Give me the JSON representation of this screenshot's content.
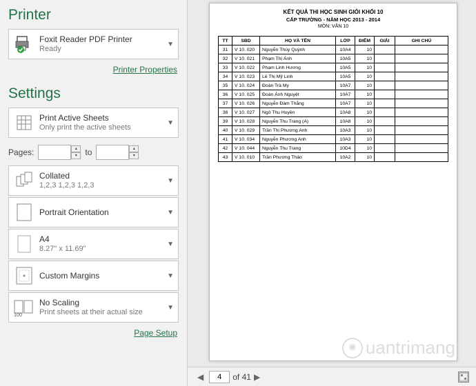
{
  "printer": {
    "section": "Printer",
    "name": "Foxit Reader PDF Printer",
    "status": "Ready",
    "properties_link": "Printer Properties"
  },
  "settings": {
    "section": "Settings",
    "print_area": {
      "main": "Print Active Sheets",
      "sub": "Only print the active sheets"
    },
    "pages": {
      "label": "Pages:",
      "from": "",
      "to_label": "to",
      "to": ""
    },
    "collate": {
      "main": "Collated",
      "sub": "1,2,3   1,2,3   1,2,3"
    },
    "orientation": {
      "main": "Portrait Orientation"
    },
    "paper": {
      "main": "A4",
      "sub": "8.27\" x 11.69\""
    },
    "margins": {
      "main": "Custom Margins"
    },
    "scaling": {
      "main": "No Scaling",
      "sub": "Print sheets at their actual size"
    },
    "page_setup_link": "Page Setup"
  },
  "preview": {
    "title1": "KẾT QUẢ THI HỌC SINH GIỎI KHỐI 10",
    "title2": "CẤP TRƯỜNG - NĂM HỌC 2013 - 2014",
    "title3": "MÔN:  VĂN 10",
    "headers": [
      "TT",
      "SBD",
      "HỌ VÀ TÊN",
      "LỚP",
      "ĐIỂM",
      "GIẢI",
      "GHI CHÚ"
    ],
    "rows": [
      [
        "31",
        "V 10. 020",
        "Nguyễn Thúy Quỳnh",
        "10A4",
        "10",
        "",
        ""
      ],
      [
        "32",
        "V 10. 021",
        "Phạm Thị Ánh",
        "10A5",
        "10",
        "",
        ""
      ],
      [
        "33",
        "V 10. 022",
        "Phạm Linh Hương",
        "10A5",
        "10",
        "",
        ""
      ],
      [
        "34",
        "V 10. 023",
        "Lê Thị Mỹ Linh",
        "10A5",
        "10",
        "",
        ""
      ],
      [
        "35",
        "V 10. 024",
        "Đoàn Trà My",
        "10A7",
        "10",
        "",
        ""
      ],
      [
        "36",
        "V 10. 025",
        "Đoàn Ánh Nguyệt",
        "10A7",
        "10",
        "",
        ""
      ],
      [
        "37",
        "V 10. 026",
        "Nguyễn Đàm Thắng",
        "10A7",
        "10",
        "",
        ""
      ],
      [
        "38",
        "V 10. 027",
        "Ngô Thu Huyền",
        "10A8",
        "10",
        "",
        ""
      ],
      [
        "39",
        "V 10. 028",
        "Nguyễn Thu Trang (A)",
        "10A8",
        "10",
        "",
        ""
      ],
      [
        "40",
        "V 10. 029",
        "Trần Thị Phương Anh",
        "10A3",
        "10",
        "",
        ""
      ],
      [
        "41",
        "V 10. 034",
        "Nguyễn Phương Anh",
        "10A3",
        "10",
        "",
        ""
      ],
      [
        "42",
        "V 10. 044",
        "Nguyễn Thu Trang",
        "10D4",
        "10",
        "",
        ""
      ],
      [
        "43",
        "V 10. 010",
        "Trần Phương Thảo",
        "10A2",
        "10",
        "",
        ""
      ]
    ]
  },
  "footer": {
    "current_page": "4",
    "total": "of 41"
  },
  "watermark": "uantrimang"
}
